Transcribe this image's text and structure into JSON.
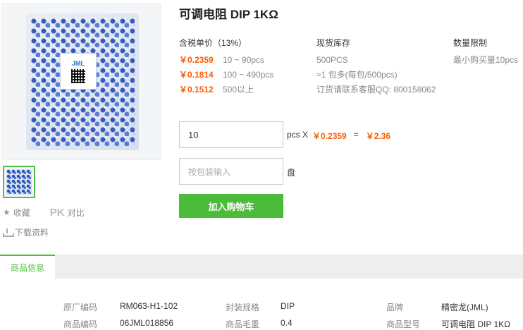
{
  "product": {
    "title": "可调电阻 DIP 1KΩ",
    "bag_brand": "JML"
  },
  "pricing": {
    "header": "含税单价（13%）",
    "tiers": [
      {
        "price": "￥0.2359",
        "range": "10 ~ 90pcs"
      },
      {
        "price": "￥0.1814",
        "range": "100 ~ 490pcs"
      },
      {
        "price": "￥0.1512",
        "range": "500以上"
      }
    ]
  },
  "stock": {
    "header": "现货库存",
    "lines": [
      "500PCS",
      "≈1 包多(每包/500pcs)",
      "订货请联系客服QQ: 800158062"
    ]
  },
  "limit": {
    "header": "数量限制",
    "text": "最小购买量10pcs"
  },
  "order": {
    "quantity_value": "10",
    "unit_label": "pcs X",
    "unit_price": "￥0.2359",
    "equals": "=",
    "total": "￥2.36",
    "pack_placeholder": "按包装输入",
    "pack_unit": "盘",
    "add_to_cart": "加入购物车"
  },
  "side": {
    "favorite": "收藏",
    "pk": "PK",
    "compare": "对比",
    "download": "下载资料"
  },
  "tabs": {
    "active": "商品信息"
  },
  "info": [
    {
      "label": "原厂编码",
      "value": "RM063-H1-102"
    },
    {
      "label": "封装规格",
      "value": "DIP"
    },
    {
      "label": "品牌",
      "value": "精密龙(JML)"
    },
    {
      "label": "商品编码",
      "value": "06JML018856"
    },
    {
      "label": "商品毛重",
      "value": "0.4"
    },
    {
      "label": "商品型号",
      "value": "可调电阻 DIP 1KΩ"
    }
  ],
  "colors": {
    "accent_green": "#4dbb3a",
    "price_orange": "#ff5a00"
  }
}
